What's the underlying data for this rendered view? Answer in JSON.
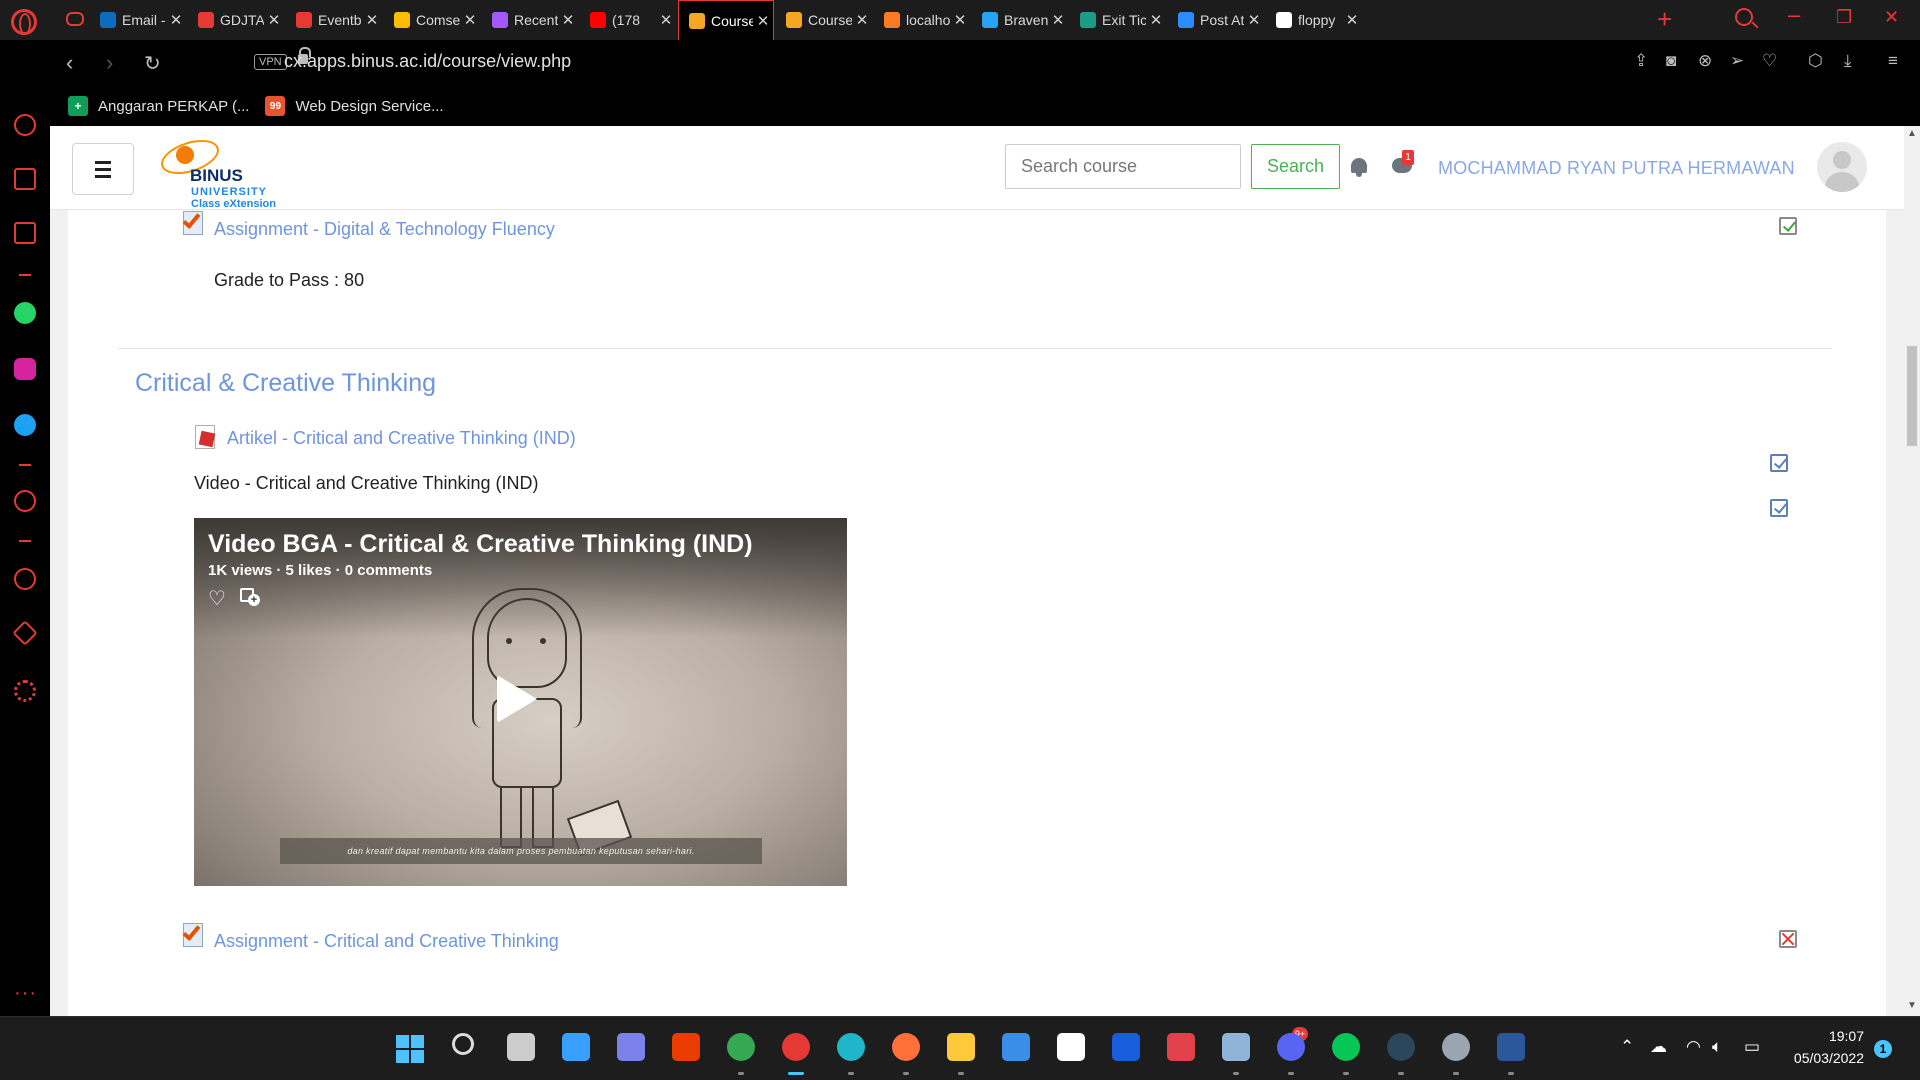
{
  "browser": {
    "tabs": [
      {
        "label": "Email -",
        "icon": "outlook-icon",
        "color": "#0f6cbd",
        "active": false
      },
      {
        "label": "GDJTAL",
        "icon": "edge-legacy-icon",
        "color": "#e53935",
        "active": false
      },
      {
        "label": "Eventbr",
        "icon": "edge-legacy-icon",
        "color": "#e53935",
        "active": false
      },
      {
        "label": "Comser",
        "icon": "google-drive-icon",
        "color": "#fbbc04",
        "active": false
      },
      {
        "label": "Recent",
        "icon": "figma-icon",
        "color": "#a259ff",
        "active": false
      },
      {
        "label": "(178",
        "icon": "youtube-icon",
        "color": "#ff0000",
        "active": false
      },
      {
        "label": "Course",
        "icon": "binus-icon",
        "color": "#f5a623",
        "active": true
      },
      {
        "label": "Course",
        "icon": "binus-icon",
        "color": "#f5a623",
        "active": false
      },
      {
        "label": "localhos",
        "icon": "xampp-icon",
        "color": "#fb7a24",
        "active": false
      },
      {
        "label": "Braven",
        "icon": "play-icon",
        "color": "#27a3f5",
        "active": false
      },
      {
        "label": "Exit Tick",
        "icon": "forms-icon",
        "color": "#1b9c85",
        "active": false
      },
      {
        "label": "Post Att",
        "icon": "zoom-icon",
        "color": "#2d8cff",
        "active": false
      },
      {
        "label": "floppy",
        "icon": "google-icon",
        "color": "#ffffff",
        "active": false
      }
    ],
    "tab_close_glyph": "✕",
    "new_tab_glyph": "+",
    "url": "cx.apps.binus.ac.id/course/view.php",
    "vpn_label": "VPN",
    "bookmarks": [
      {
        "label": "Anggaran PERKAP (...",
        "icon": "sheets-icon",
        "color": "#0f9d58",
        "glyph": "+"
      },
      {
        "label": "Web Design Service...",
        "icon": "99designs-icon",
        "color": "#e8542f",
        "glyph": "99"
      }
    ]
  },
  "page": {
    "search": {
      "placeholder": "Search course",
      "button_label": "Search"
    },
    "notifications": {
      "message_count": "1"
    },
    "user_name": "MOCHAMMAD RYAN PUTRA HERMAWAN",
    "logo": {
      "line1": "BINUS",
      "line2": "UNIVERSITY",
      "line3": "Class eXtension"
    },
    "items": {
      "assignment_dtf": {
        "label": "Assignment - Digital & Technology Fluency",
        "grade_to_pass": "Grade to Pass : 80"
      },
      "section_title": "Critical & Creative Thinking",
      "article": {
        "label": "Artikel - Critical and Creative Thinking (IND)"
      },
      "video_label": "Video - Critical and Creative Thinking (IND)",
      "video": {
        "title": "Video BGA - Critical & Creative Thinking (IND)",
        "stats": "1K views · 5 likes · 0 comments",
        "caption": "dan kreatif dapat membantu kita dalam proses pembuatan keputusan sehari-hari."
      },
      "assignment_cct": {
        "label": "Assignment - Critical and Creative Thinking"
      }
    }
  },
  "taskbar": {
    "apps": [
      "windows-start",
      "search",
      "task-view",
      "widgets",
      "teams-chat",
      "office",
      "chrome",
      "opera",
      "edge",
      "firefox",
      "file-explorer",
      "mail",
      "dropbox",
      "bitwarden",
      "pen",
      "game-controller",
      "discord",
      "line",
      "steam",
      "settings",
      "word"
    ],
    "discord_badge": "9+",
    "time": "19:07",
    "date": "05/03/2022",
    "notification_count": "1"
  }
}
